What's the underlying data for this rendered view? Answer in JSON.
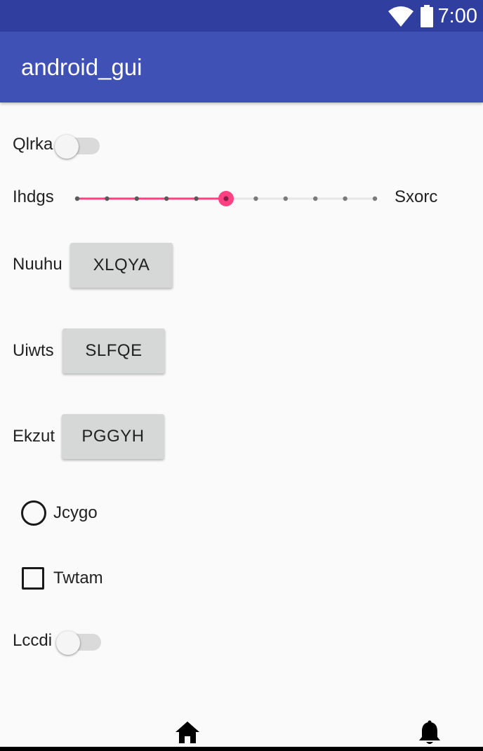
{
  "status_bar": {
    "time": "7:00",
    "icons": [
      "wifi-icon",
      "battery-icon"
    ]
  },
  "app_bar": {
    "title": "android_gui",
    "color": "#3f51b5"
  },
  "controls": {
    "switch_1": {
      "label": "Qlrka",
      "checked": false
    },
    "slider": {
      "label_left": "Ihdgs",
      "label_right": "Sxorc",
      "steps": 10,
      "value": 5,
      "accent": "#ff4081"
    },
    "row_1": {
      "label": "Nuuhu",
      "button": "XLQYA"
    },
    "row_2": {
      "label": "Uiwts",
      "button": "SLFQE"
    },
    "row_3": {
      "label": "Ekzut",
      "button": "PGGYH"
    },
    "radio": {
      "label": "Jcygo",
      "checked": false
    },
    "checkbox": {
      "label": "Twtam",
      "checked": false
    },
    "switch_2": {
      "label": "Lccdi",
      "checked": false
    }
  },
  "bottom_nav": {
    "icons": [
      "home-icon",
      "bell-icon"
    ]
  }
}
